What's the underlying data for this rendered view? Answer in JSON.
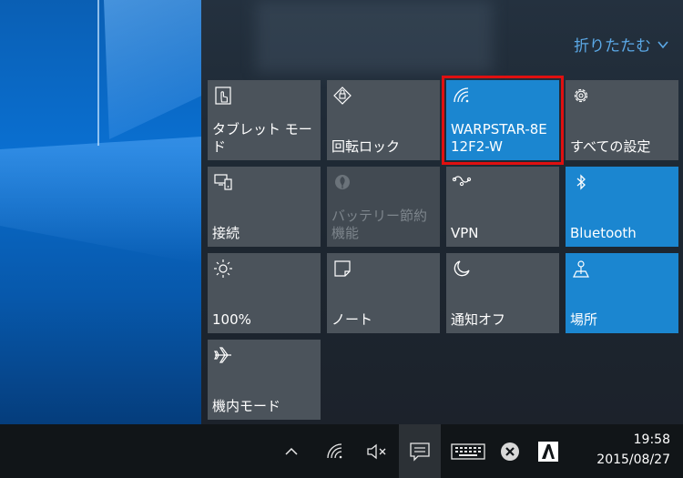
{
  "action_center": {
    "collapse_label": "折りたたむ",
    "accent_color": "#5ba8e6",
    "tiles": [
      {
        "label": "タブレット モード",
        "icon": "tablet-mode-icon",
        "state": "off"
      },
      {
        "label": "回転ロック",
        "icon": "rotation-lock-icon",
        "state": "off"
      },
      {
        "label": "WARPSTAR-8E 12F2-W",
        "icon": "wifi-icon",
        "state": "on",
        "highlighted": true
      },
      {
        "label": "すべての設定",
        "icon": "gear-icon",
        "state": "off"
      },
      {
        "label": "接続",
        "icon": "connect-icon",
        "state": "off"
      },
      {
        "label": "バッテリー節約機能",
        "icon": "battery-saver-icon",
        "state": "disabled"
      },
      {
        "label": "VPN",
        "icon": "vpn-icon",
        "state": "off"
      },
      {
        "label": "Bluetooth",
        "icon": "bluetooth-icon",
        "state": "on"
      },
      {
        "label": "100%",
        "icon": "brightness-icon",
        "state": "off"
      },
      {
        "label": "ノート",
        "icon": "note-icon",
        "state": "off"
      },
      {
        "label": "通知オフ",
        "icon": "quiet-hours-icon",
        "state": "off"
      },
      {
        "label": "場所",
        "icon": "location-icon",
        "state": "on"
      },
      {
        "label": "機内モード",
        "icon": "airplane-icon",
        "state": "off"
      }
    ],
    "active_color": "#1b86d0",
    "highlight_color": "#e01010"
  },
  "taskbar": {
    "time": "19:58",
    "date": "2015/08/27",
    "icons": [
      "chevron-up-icon",
      "wifi-icon",
      "speaker-muted-icon",
      "action-center-icon",
      "keyboard-icon",
      "close-circle-icon",
      "font-a-icon"
    ]
  }
}
